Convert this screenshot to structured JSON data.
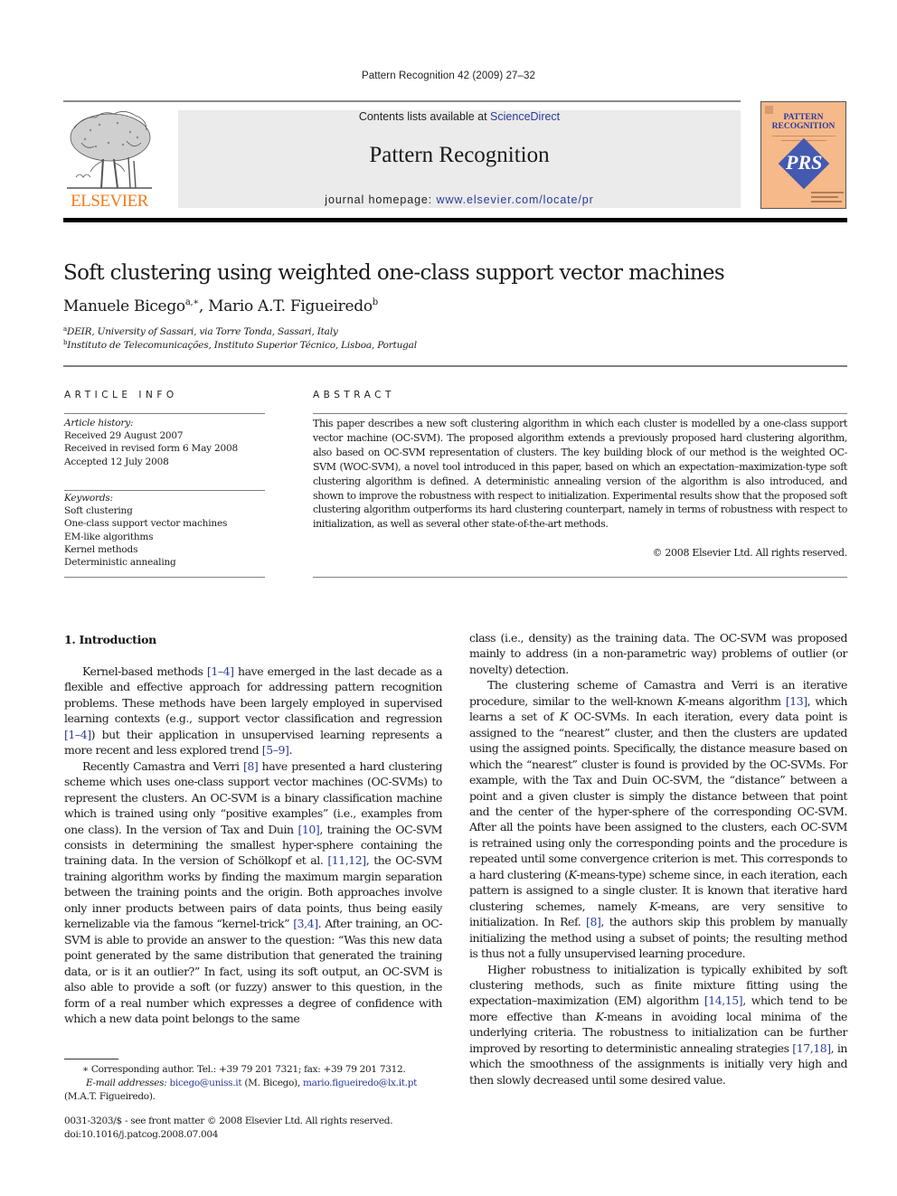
{
  "running_head": "Pattern Recognition 42 (2009) 27–32",
  "publisher": {
    "logo_icon": "elsevier-tree-logo",
    "name": "ELSEVIER",
    "brand_color": "#f07c1c"
  },
  "banner": {
    "contents_prefix": "Contents lists available at ",
    "contents_link": "ScienceDirect",
    "journal_title": "Pattern Recognition",
    "homepage_prefix": "journal homepage: ",
    "homepage_link": "www.elsevier.com/locate/pr"
  },
  "cover": {
    "title_line1": "PATTERN",
    "title_line2": "RECOGNITION",
    "monogram": "PRS",
    "bg_color": "#f6b98a",
    "accent_color": "#4459b0"
  },
  "article": {
    "title": "Soft clustering using weighted one-class support vector machines",
    "authors": [
      {
        "name": "Manuele Bicego",
        "marks": "a,∗"
      },
      {
        "name": "Mario A.T. Figueiredo",
        "marks": "b"
      }
    ],
    "author_separator": ", ",
    "affiliations": [
      {
        "mark": "a",
        "text": "DEIR, University of Sassari, via Torre Tonda, Sassari, Italy"
      },
      {
        "mark": "b",
        "text": "Instituto de Telecomunicações, Instituto Superior Técnico, Lisboa, Portugal"
      }
    ]
  },
  "article_info": {
    "heading": "ARTICLE INFO",
    "history_label": "Article history:",
    "history": [
      "Received 29 August 2007",
      "Received in revised form 6 May 2008",
      "Accepted 12 July 2008"
    ],
    "keywords_label": "Keywords:",
    "keywords": [
      "Soft clustering",
      "One-class support vector machines",
      "EM-like algorithms",
      "Kernel methods",
      "Deterministic annealing"
    ]
  },
  "abstract": {
    "heading": "ABSTRACT",
    "text": "This paper describes a new soft clustering algorithm in which each cluster is modelled by a one-class support vector machine (OC-SVM). The proposed algorithm extends a previously proposed hard clustering algorithm, also based on OC-SVM representation of clusters. The key building block of our method is the weighted OC-SVM (WOC-SVM), a novel tool introduced in this paper, based on which an expectation–maximization-type soft clustering algorithm is defined. A deterministic annealing version of the algorithm is also introduced, and shown to improve the robustness with respect to initialization. Experimental results show that the proposed soft clustering algorithm outperforms its hard clustering counterpart, namely in terms of robustness with respect to initialization, as well as several other state-of-the-art methods.",
    "copyright": "© 2008 Elsevier Ltd. All rights reserved."
  },
  "body": {
    "section_heading": "1.  Introduction",
    "link_color": "#2a3a9a",
    "p1": [
      {
        "t": "Kernel-based methods "
      },
      {
        "ref": "[1–4]"
      },
      {
        "t": " have emerged in the last decade as a flexible and effective approach for addressing pattern recognition problems. These methods have been largely employed in supervised learning contexts (e.g., support vector classification and regression "
      },
      {
        "ref": "[1–4]"
      },
      {
        "t": ") but their application in unsupervised learning represents a more recent and less explored trend "
      },
      {
        "ref": "[5–9]"
      },
      {
        "t": "."
      }
    ],
    "p2": [
      {
        "t": "Recently Camastra and Verri "
      },
      {
        "ref": "[8]"
      },
      {
        "t": " have presented a hard clustering scheme which uses one-class support vector machines (OC-SVMs) to represent the clusters. An OC-SVM is a binary classification machine which is trained using only “positive examples” (i.e., examples from one class). In the version of Tax and Duin "
      },
      {
        "ref": "[10]"
      },
      {
        "t": ", training the OC-SVM consists in determining the smallest hyper-sphere containing the training data. In the version of Schölkopf et al. "
      },
      {
        "ref": "[11,12]"
      },
      {
        "t": ", the OC-SVM training algorithm works by finding the maximum margin separation between the training points and the origin. Both approaches involve only inner products between pairs of data points, thus being easily kernelizable via the famous “kernel-trick” "
      },
      {
        "ref": "[3,4]"
      },
      {
        "t": ". After training, an OC-SVM is able to provide an answer to the question: “Was this new data point generated by the same distribution that generated the training data, or is it an outlier?” In fact, using its soft output, an OC-SVM is also able to provide a soft (or fuzzy) answer to this question, in the form of a real number which expresses a degree of confidence with which a new data point belongs to the same"
      }
    ],
    "p2_cont": [
      {
        "t": "class (i.e., density) as the training data. The OC-SVM was proposed mainly to address (in a non-parametric way) problems of outlier (or novelty) detection."
      }
    ],
    "p3": [
      {
        "t": "The clustering scheme of Camastra and Verri is an iterative procedure, similar to the well-known "
      },
      {
        "i": "K"
      },
      {
        "t": "-means algorithm "
      },
      {
        "ref": "[13]"
      },
      {
        "t": ", which learns a set of "
      },
      {
        "i": "K"
      },
      {
        "t": " OC-SVMs. In each iteration, every data point is assigned to the “nearest” cluster, and then the clusters are updated using the assigned points. Specifically, the distance measure based on which the “nearest” cluster is found is provided by the OC-SVMs. For example, with the Tax and Duin OC-SVM, the “distance” between a point and a given cluster is simply the distance between that point and the center of the hyper-sphere of the corresponding OC-SVM. After all the points have been assigned to the clusters, each OC-SVM is retrained using only the corresponding points and the procedure is repeated until some convergence criterion is met. This corresponds to a hard clustering ("
      },
      {
        "i": "K"
      },
      {
        "t": "-means-type) scheme since, in each iteration, each pattern is assigned to a single cluster. It is known that iterative hard clustering schemes, namely "
      },
      {
        "i": "K"
      },
      {
        "t": "-means, are very sensitive to initialization. In Ref. "
      },
      {
        "ref": "[8]"
      },
      {
        "t": ", the authors skip this problem by manually initializing the method using a subset of points; the resulting method is thus not a fully unsupervised learning procedure."
      }
    ],
    "p4": [
      {
        "t": "Higher robustness to initialization is typically exhibited by soft clustering methods, such as finite mixture fitting using the expectation–maximization (EM) algorithm "
      },
      {
        "ref": "[14,15]"
      },
      {
        "t": ", which tend to be more effective than "
      },
      {
        "i": "K"
      },
      {
        "t": "-means in avoiding local minima of the underlying criteria. The robustness to initialization can be further improved by resorting to deterministic annealing strategies "
      },
      {
        "ref": "[17,18]"
      },
      {
        "t": ", in which the smoothness of the assignments is initially very high and then slowly decreased until some desired value."
      }
    ]
  },
  "footnote": {
    "mark": "∗",
    "corresponding": " Corresponding author. Tel.: +39 79 201 7321; fax: +39 79 201 7312.",
    "email_label": "E-mail addresses:",
    "email1": "bicego@uniss.it",
    "email1_owner": " (M. Bicego), ",
    "email2": "mario.figueiredo@lx.it.pt",
    "email2_owner": "(M.A.T. Figueiredo)."
  },
  "front_matter": {
    "issn_line": "0031-3203/$ - see front matter © 2008 Elsevier Ltd. All rights reserved.",
    "doi": "doi:10.1016/j.patcog.2008.07.004"
  }
}
